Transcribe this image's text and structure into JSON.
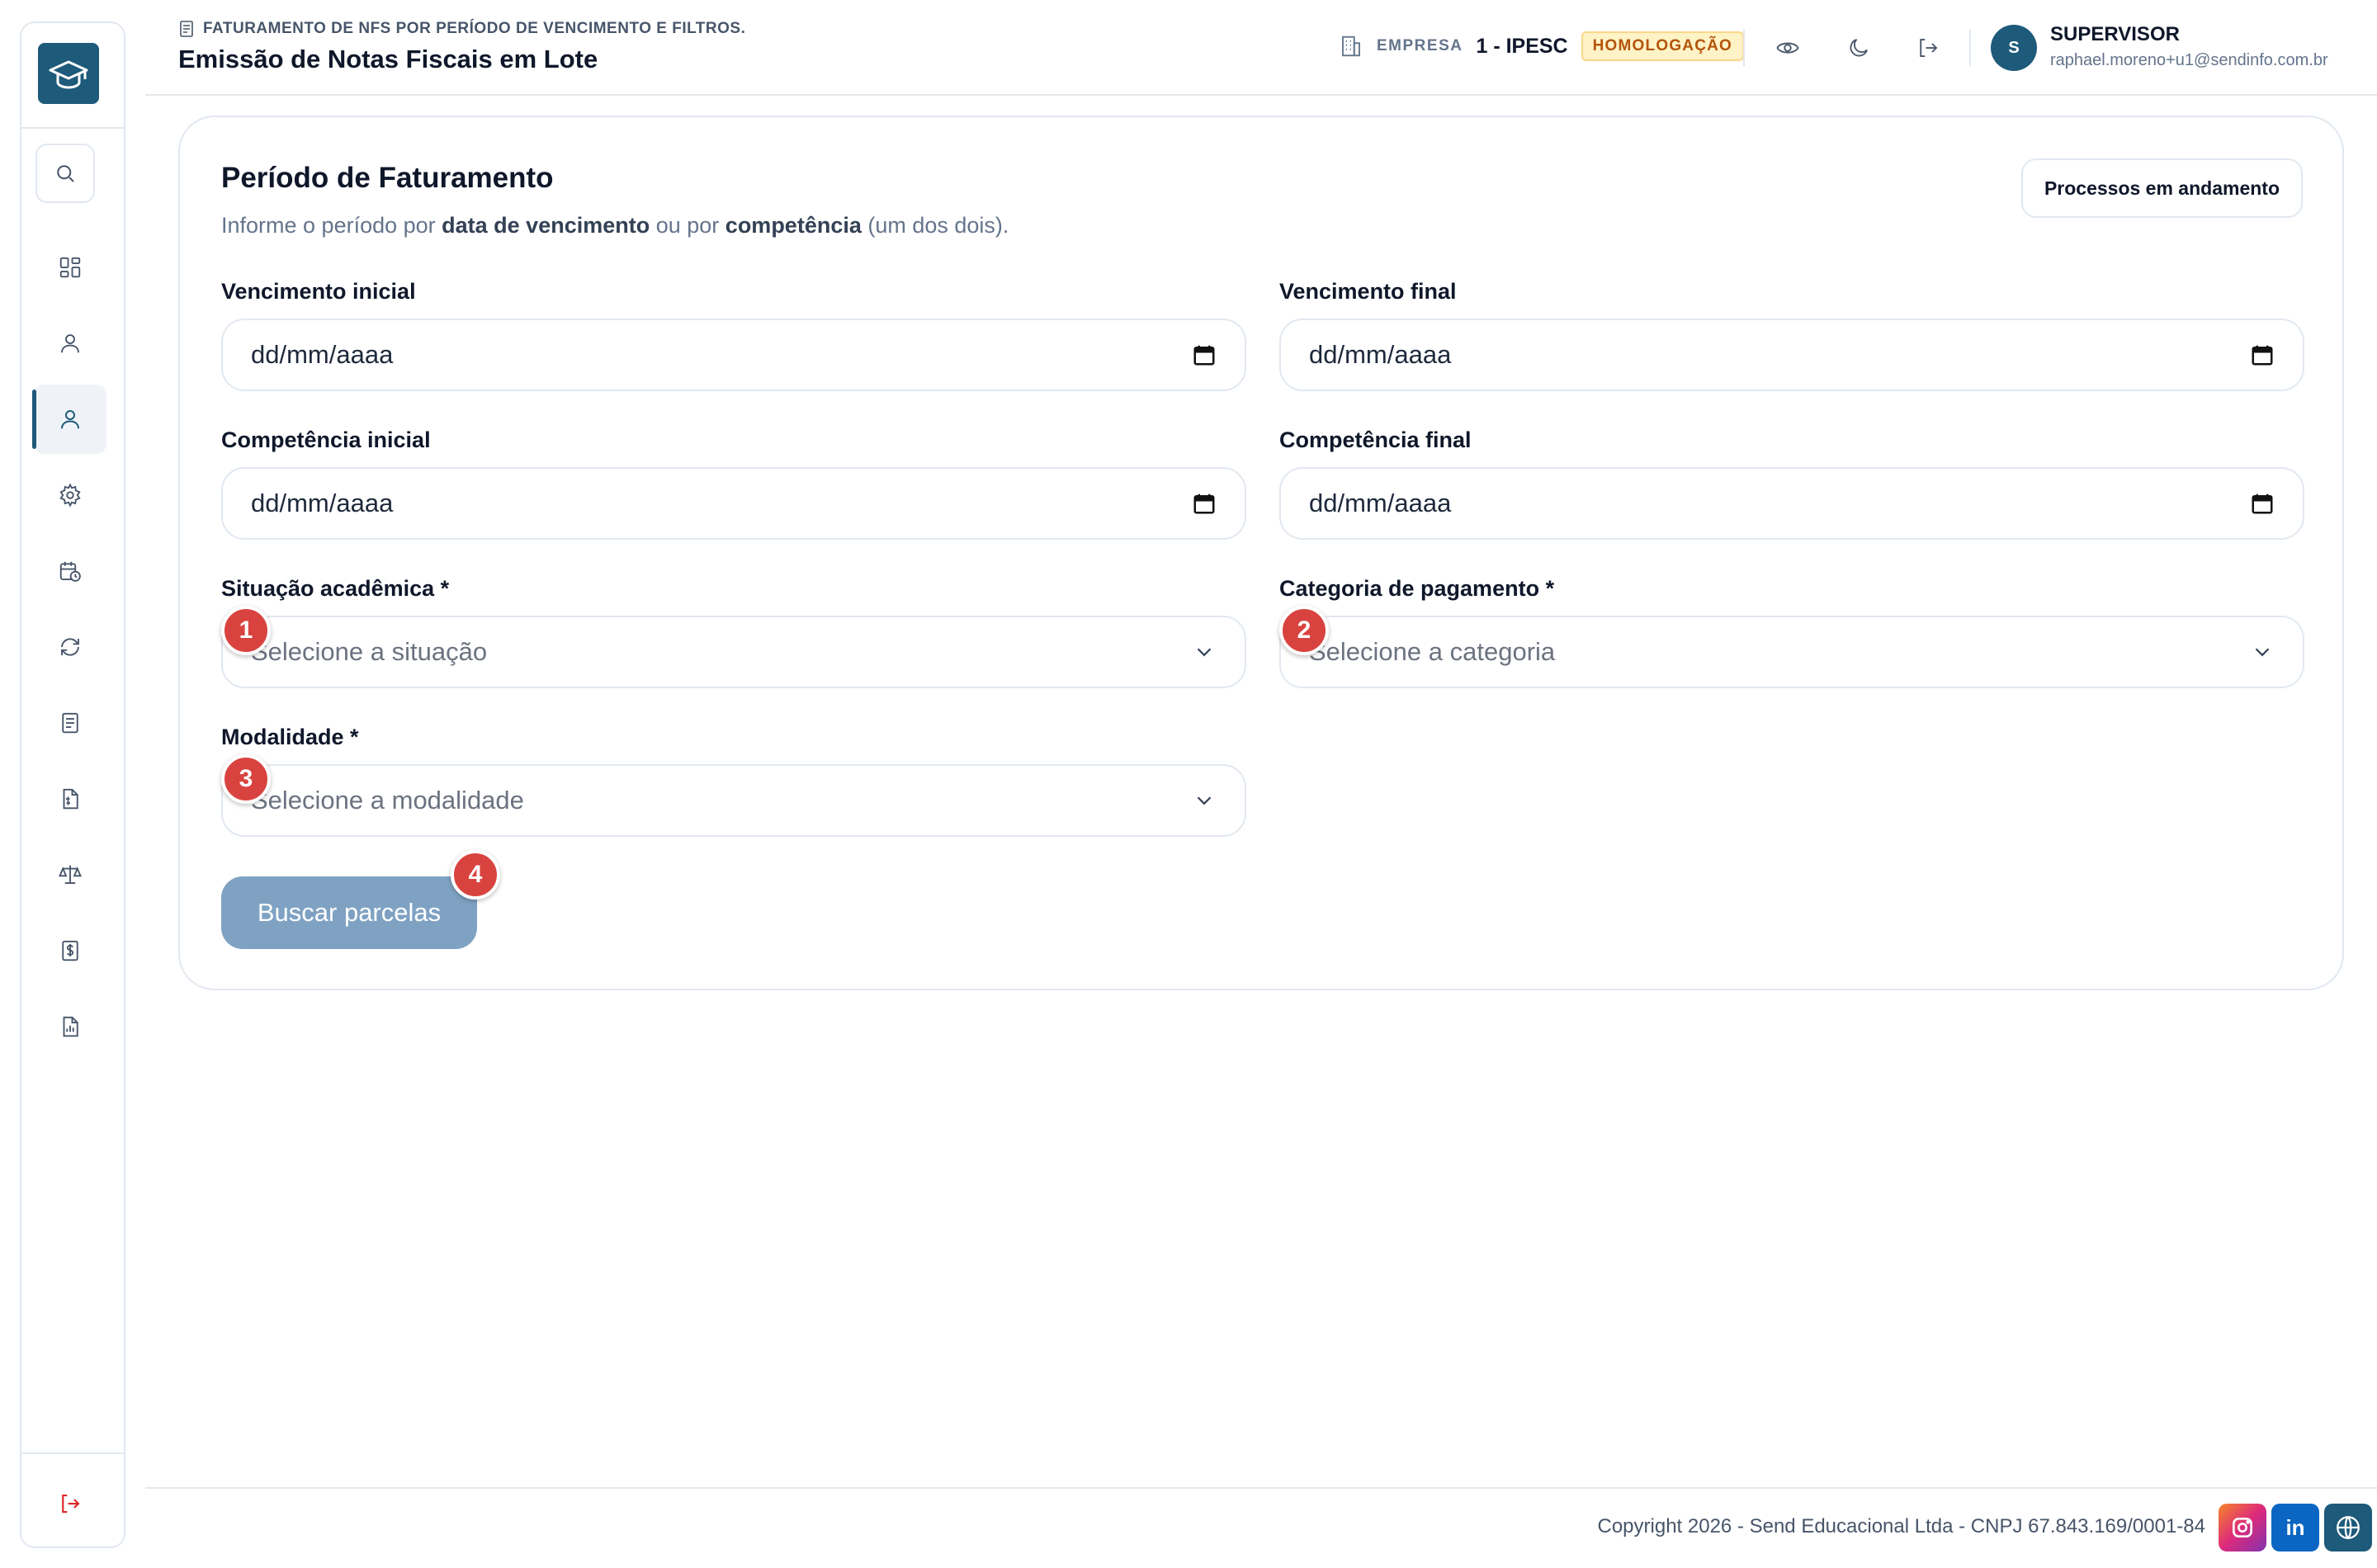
{
  "header": {
    "breadcrumb": "FATURAMENTO DE NFS POR PERÍODO DE VENCIMENTO E FILTROS.",
    "title": "Emissão de Notas Fiscais em Lote",
    "empresa_label": "EMPRESA",
    "empresa_name": "1 - IPESC",
    "env_badge": "HOMOLOGAÇÃO",
    "user_initial": "S",
    "user_name": "SUPERVISOR",
    "user_email": "raphael.moreno+u1@sendinfo.com.br"
  },
  "sidebar": {
    "items": [
      {
        "icon": "dashboard-icon"
      },
      {
        "icon": "user-icon"
      },
      {
        "icon": "user-active-icon",
        "active": true
      },
      {
        "icon": "gear-icon"
      },
      {
        "icon": "calendar-clock-icon"
      },
      {
        "icon": "refresh-icon"
      },
      {
        "icon": "document-icon"
      },
      {
        "icon": "file-invoice-icon"
      },
      {
        "icon": "scale-icon"
      },
      {
        "icon": "dollar-document-icon"
      },
      {
        "icon": "report-icon"
      }
    ]
  },
  "card": {
    "title": "Período de Faturamento",
    "subtitle_pre": "Informe o período por ",
    "subtitle_b1": "data de vencimento",
    "subtitle_mid": " ou por ",
    "subtitle_b2": "competência",
    "subtitle_post": " (um dos dois).",
    "process_button": "Processos em andamento",
    "fields": {
      "venc_inicial": {
        "label": "Vencimento inicial",
        "value": "dd/mm/aaaa"
      },
      "venc_final": {
        "label": "Vencimento final",
        "value": "dd/mm/aaaa"
      },
      "comp_inicial": {
        "label": "Competência inicial",
        "value": "dd/mm/aaaa"
      },
      "comp_final": {
        "label": "Competência final",
        "value": "dd/mm/aaaa"
      },
      "situacao": {
        "label": "Situação acadêmica *",
        "placeholder": "Selecione a situação"
      },
      "categoria": {
        "label": "Categoria de pagamento *",
        "placeholder": "Selecione a categoria"
      },
      "modalidade": {
        "label": "Modalidade *",
        "placeholder": "Selecione a modalidade"
      }
    },
    "search_button": "Buscar parcelas",
    "markers": [
      "1",
      "2",
      "3",
      "4"
    ]
  },
  "footer": {
    "copyright": "Copyright 2026 - Send Educacional Ltda - CNPJ 67.843.169/0001-84",
    "linkedin_label": "in"
  },
  "colors": {
    "brand": "#1e5a7a",
    "marker": "#d9433f",
    "search_button": "#7fa2c3",
    "badge_bg": "#fef3c7",
    "badge_text": "#b45309",
    "logout": "#dc2626"
  }
}
